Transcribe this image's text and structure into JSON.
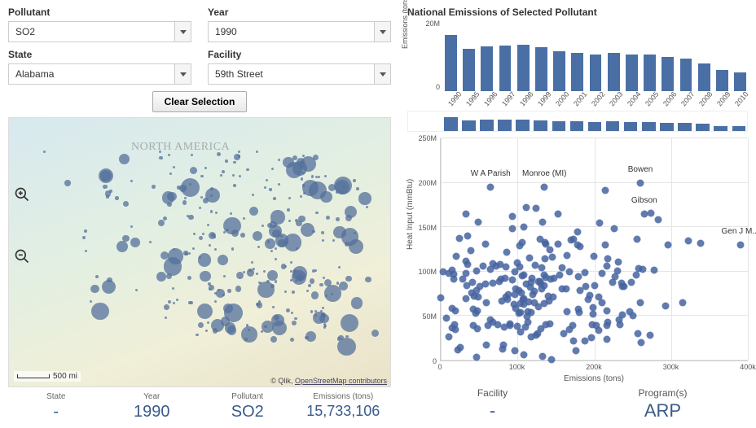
{
  "filters": {
    "pollutant": {
      "label": "Pollutant",
      "value": "SO2"
    },
    "year": {
      "label": "Year",
      "value": "1990"
    },
    "state": {
      "label": "State",
      "value": "Alabama"
    },
    "facility": {
      "label": "Facility",
      "value": "59th Street"
    }
  },
  "clear_button": "Clear Selection",
  "map": {
    "label": "NORTH AMERICA",
    "scale": "500 mi",
    "attr_prefix": "© Qlik, ",
    "attr_link": "OpenStreetMap contributors"
  },
  "summary_left": {
    "state": {
      "label": "State",
      "value": "-"
    },
    "year": {
      "label": "Year",
      "value": "1990"
    },
    "pollutant": {
      "label": "Pollutant",
      "value": "SO2"
    },
    "emissions": {
      "label": "Emissions (tons)",
      "value": "15,733,106"
    }
  },
  "bar_chart": {
    "title": "National Emissions of Selected Pollutant",
    "ylabel": "Emissions (tons)",
    "yticks": [
      "0",
      "20M"
    ]
  },
  "chart_data": [
    {
      "type": "bar",
      "title": "National Emissions of Selected Pollutant",
      "ylabel": "Emissions (tons)",
      "ylim": [
        0,
        20000000
      ],
      "categories": [
        "1990",
        "1995",
        "1996",
        "1997",
        "1998",
        "1999",
        "2000",
        "2001",
        "2002",
        "2003",
        "2004",
        "2005",
        "2006",
        "2007",
        "2008",
        "2009",
        "2010"
      ],
      "values": [
        15700000,
        11800000,
        12500000,
        12800000,
        12900000,
        12200000,
        11200000,
        10700000,
        10300000,
        10600000,
        10300000,
        10200000,
        9500000,
        9000000,
        7800000,
        5900000,
        5200000
      ]
    },
    {
      "type": "scatter",
      "xlabel": "Emissions (tons)",
      "ylabel": "Heat Input (mmBtu)",
      "xlim": [
        0,
        400000
      ],
      "ylim": [
        0,
        250000000
      ],
      "annotations": [
        {
          "name": "W A Parish",
          "x": 65000,
          "y": 195000000
        },
        {
          "name": "Monroe (MI)",
          "x": 135000,
          "y": 195000000
        },
        {
          "name": "Bowen",
          "x": 260000,
          "y": 200000000
        },
        {
          "name": "Gibson",
          "x": 265000,
          "y": 165000000
        },
        {
          "name": "Gen J M...",
          "x": 390000,
          "y": 130000000
        }
      ],
      "xticks": [
        "0",
        "100k",
        "200k",
        "300k",
        "400k"
      ],
      "yticks": [
        "0",
        "50M",
        "100M",
        "150M",
        "200M",
        "250M"
      ]
    }
  ],
  "scatter": {
    "ylabel": "Heat Input (mmBtu)",
    "xlabel": "Emissions (tons)"
  },
  "summary_right": {
    "facility": {
      "label": "Facility",
      "value": "-"
    },
    "programs": {
      "label": "Program(s)",
      "value": "ARP"
    }
  }
}
